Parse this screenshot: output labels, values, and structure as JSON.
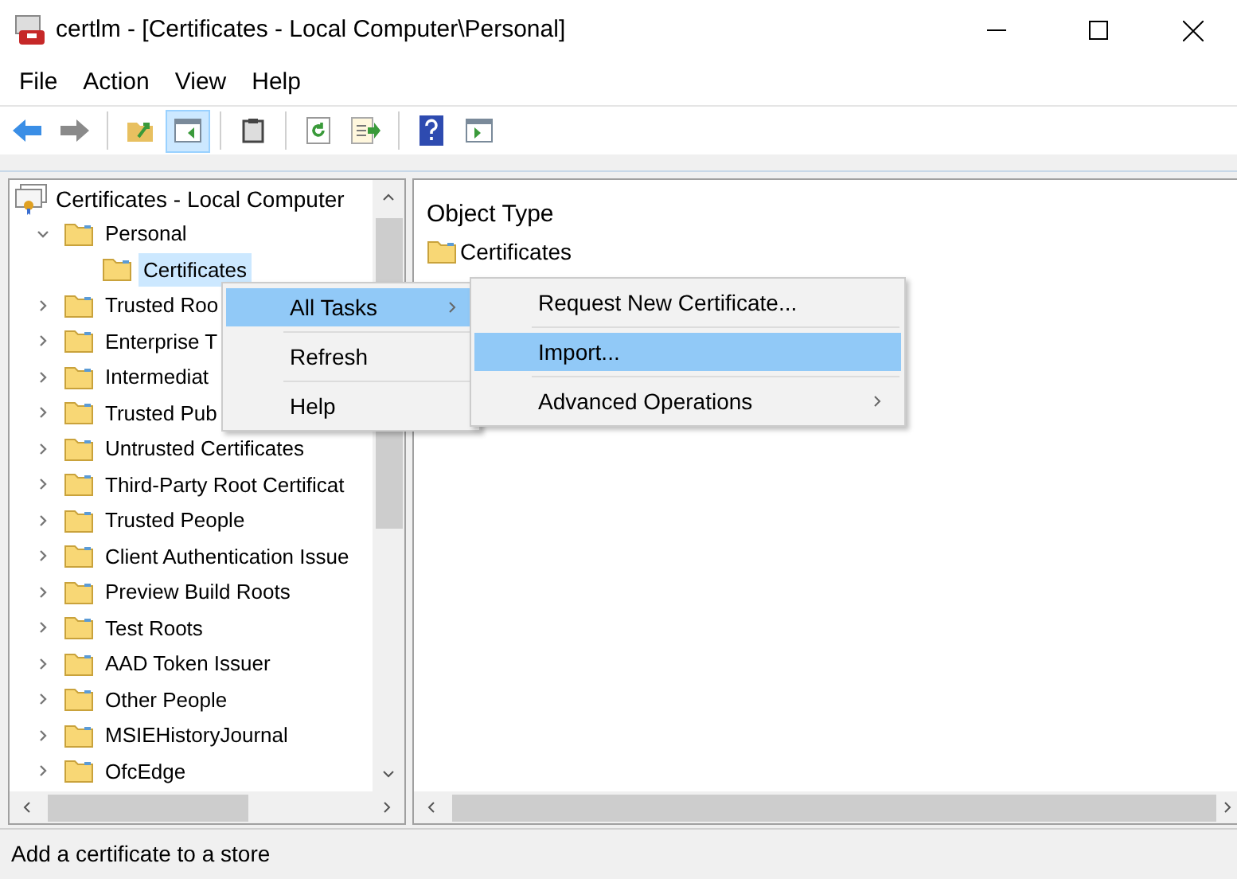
{
  "window": {
    "title": "certlm - [Certificates - Local Computer\\Personal]"
  },
  "menu_bar": [
    "File",
    "Action",
    "View",
    "Help"
  ],
  "toolbar": [
    {
      "kind": "back",
      "pressed": false
    },
    {
      "kind": "forward",
      "pressed": false
    },
    {
      "kind": "separator"
    },
    {
      "kind": "up",
      "pressed": false
    },
    {
      "kind": "tree",
      "pressed": true
    },
    {
      "kind": "separator"
    },
    {
      "kind": "clipboard",
      "pressed": false
    },
    {
      "kind": "separator"
    },
    {
      "kind": "refresh",
      "pressed": false
    },
    {
      "kind": "export",
      "pressed": false
    },
    {
      "kind": "separator"
    },
    {
      "kind": "help",
      "pressed": false
    },
    {
      "kind": "action_pane",
      "pressed": false
    }
  ],
  "tree": {
    "label": "Certificates - Local Computer",
    "children": [
      {
        "label": "Personal",
        "expanded": true,
        "selected": false,
        "children": [
          {
            "label": "Certificates",
            "selected": true
          }
        ]
      },
      {
        "label": "Trusted Roo",
        "expanded": false,
        "selected": false
      },
      {
        "label": "Enterprise T",
        "expanded": false,
        "selected": false
      },
      {
        "label": "Intermediat",
        "expanded": false,
        "selected": false
      },
      {
        "label": "Trusted Pub",
        "expanded": false,
        "selected": false
      },
      {
        "label": "Untrusted Certificates",
        "expanded": false,
        "selected": false
      },
      {
        "label": "Third-Party Root Certificat",
        "expanded": false,
        "selected": false
      },
      {
        "label": "Trusted People",
        "expanded": false,
        "selected": false
      },
      {
        "label": "Client Authentication Issue",
        "expanded": false,
        "selected": false
      },
      {
        "label": "Preview Build Roots",
        "expanded": false,
        "selected": false
      },
      {
        "label": "Test Roots",
        "expanded": false,
        "selected": false
      },
      {
        "label": "AAD Token Issuer",
        "expanded": false,
        "selected": false
      },
      {
        "label": "Other People",
        "expanded": false,
        "selected": false
      },
      {
        "label": "MSIEHistoryJournal",
        "expanded": false,
        "selected": false
      },
      {
        "label": "OfcEdge",
        "expanded": false,
        "selected": false
      }
    ]
  },
  "details": {
    "columns": [
      "Object Type"
    ],
    "rows": [
      "Certificates"
    ]
  },
  "context_menu": {
    "items": [
      {
        "label": "All Tasks",
        "selected": true,
        "submenu": true
      },
      {
        "label": "Refresh",
        "selected": false,
        "submenu": false
      },
      {
        "label": "Help",
        "selected": false,
        "submenu": false
      }
    ]
  },
  "submenu": {
    "items": [
      {
        "label": "Request New Certificate...",
        "selected": false,
        "submenu": false
      },
      {
        "label": "Import...",
        "selected": true,
        "submenu": false
      },
      {
        "label": "Advanced Operations",
        "selected": false,
        "submenu": true
      }
    ]
  },
  "status_bar": "Add a certificate to a store"
}
